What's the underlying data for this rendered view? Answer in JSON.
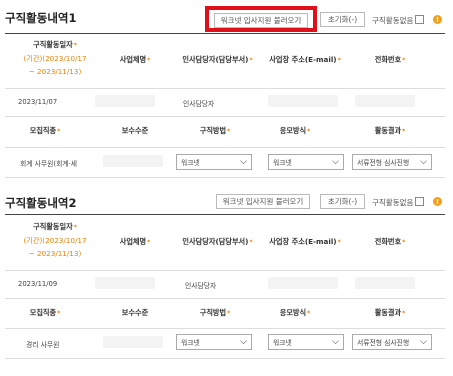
{
  "section1": {
    "title": "구직활동내역1",
    "load_button": "워크넷 입사지원 불러오기",
    "reset_button": "초기화(-)",
    "no_activity_label": "구직활동없음",
    "headers": {
      "date": "구직활동일자",
      "period_line1": "(기간)(2023/10/17",
      "period_line2": "~ 2023/11/13)",
      "company": "사업체명",
      "person": "인사담당자(담당부서)",
      "address": "사업장 주소(E-mail)",
      "phone": "전화번호"
    },
    "row": {
      "date": "2023/11/07",
      "company": "",
      "person": "인사담당자",
      "address": "",
      "phone": ""
    },
    "headers2": {
      "field": "모집직종",
      "salary": "보수수준",
      "method": "구직방법",
      "apply": "응모방식",
      "result": "활동결과"
    },
    "row2": {
      "field": "회계 사무원(회계·세",
      "salary": "",
      "method": "워크넷",
      "apply": "워크넷",
      "result": "서류전형 심사진행"
    }
  },
  "section2": {
    "title": "구직활동내역2",
    "load_button": "워크넷 입사지원 불러오기",
    "reset_button": "초기화(-)",
    "no_activity_label": "구직활동없음",
    "headers": {
      "date": "구직활동일자",
      "period_line1": "(기간)(2023/10/17",
      "period_line2": "~ 2023/11/13)",
      "company": "사업체명",
      "person": "인사담당자(담당부서)",
      "address": "사업장 주소(E-mail)",
      "phone": "전화번호"
    },
    "row": {
      "date": "2023/11/09",
      "company": "",
      "person": "인사담당자",
      "address": "",
      "phone": ""
    },
    "headers2": {
      "field": "모집직종",
      "salary": "보수수준",
      "method": "구직방법",
      "apply": "응모방식",
      "result": "활동결과"
    },
    "row2": {
      "field": "경리 사무원",
      "salary": "",
      "method": "워크넷",
      "apply": "워크넷",
      "result": "서류전형 심사진행"
    }
  },
  "required_mark": "*",
  "info_icon": "!",
  "colors": {
    "required": "#f08000",
    "highlight": "#e0101a",
    "info": "#f0a020"
  }
}
